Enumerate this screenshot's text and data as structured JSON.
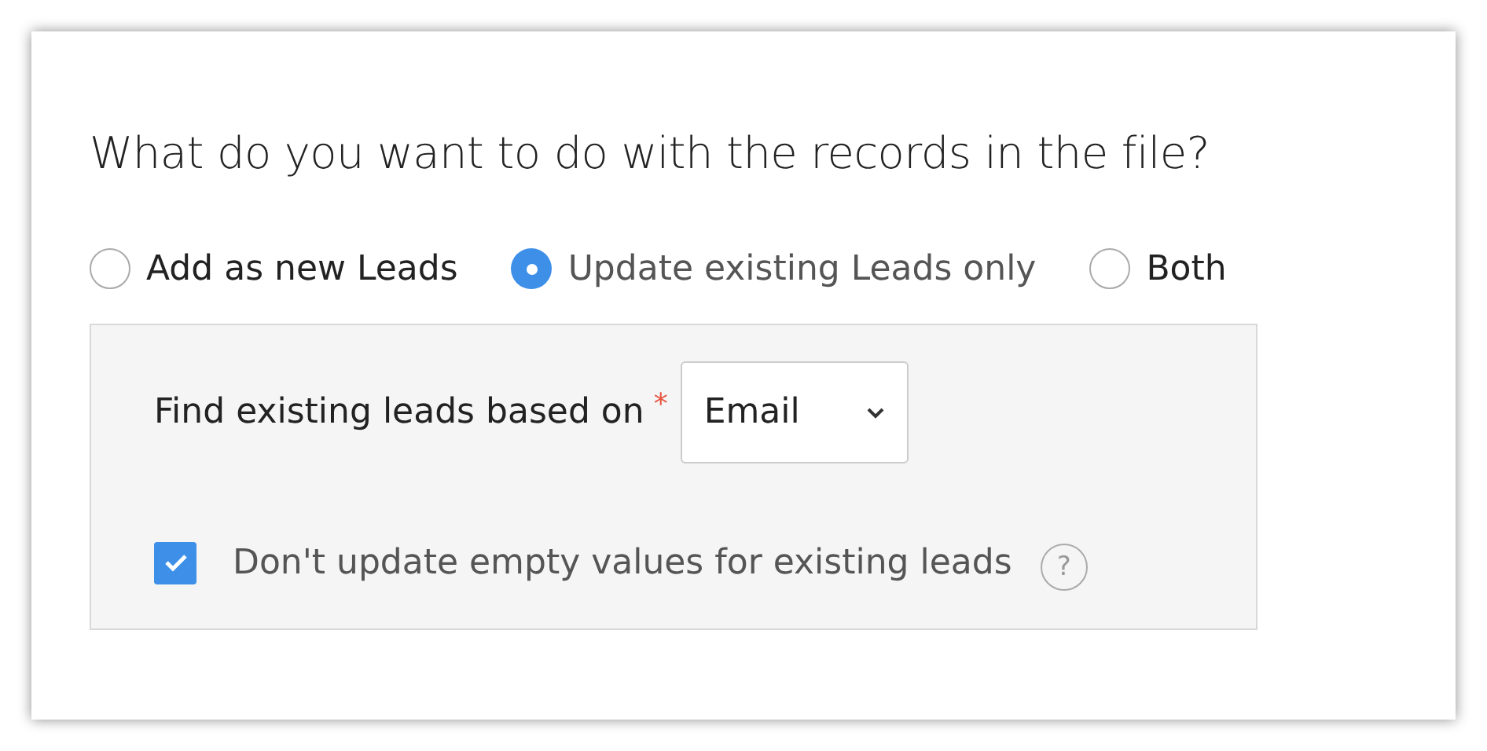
{
  "title": "What do you want to do with the records in the file?",
  "options": [
    {
      "label": "Add as new Leads",
      "selected": false
    },
    {
      "label": "Update existing Leads only",
      "selected": true
    },
    {
      "label": "Both",
      "selected": false
    }
  ],
  "match": {
    "label": "Find existing leads based on",
    "required_mark": "*",
    "value": "Email"
  },
  "skip_empty": {
    "label": "Don't update empty values for existing leads",
    "checked": true,
    "help": "?"
  }
}
